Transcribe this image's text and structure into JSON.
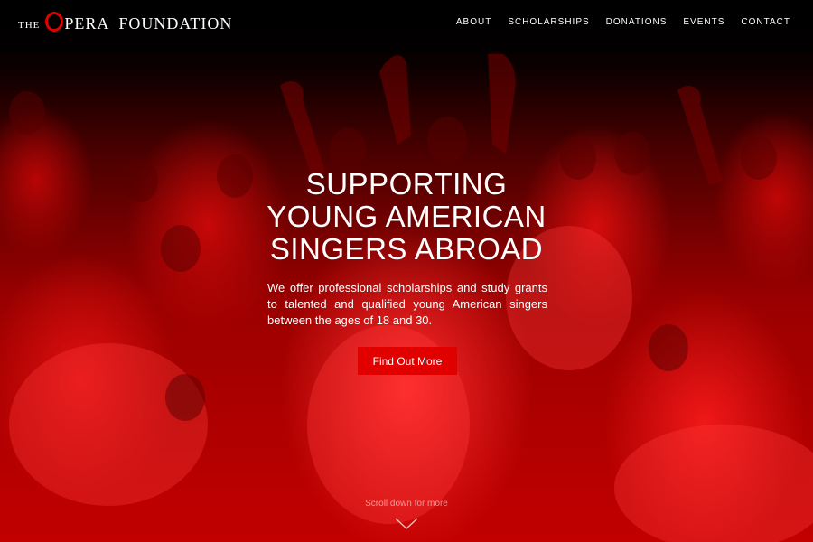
{
  "logo": {
    "the": "THE",
    "rest_1": "PERA",
    "rest_2": "FOUNDATION"
  },
  "nav": [
    {
      "label": "ABOUT"
    },
    {
      "label": "SCHOLARSHIPS"
    },
    {
      "label": "DONATIONS"
    },
    {
      "label": "EVENTS"
    },
    {
      "label": "CONTACT"
    }
  ],
  "hero": {
    "headline": [
      "SUPPORTING",
      "YOUNG AMERICAN",
      "SINGERS ABROAD"
    ],
    "intro": "We offer professional scholarships and study grants to talented and qualified young American singers between the ages of 18 and 30.",
    "cta_label": "Find Out More",
    "scroll_hint": "Scroll down for more"
  },
  "colors": {
    "accent": "#e00000",
    "background": "#000000"
  },
  "icons": {
    "scroll": "chevron-down-icon",
    "logo_mark": "opera-o-mark"
  }
}
